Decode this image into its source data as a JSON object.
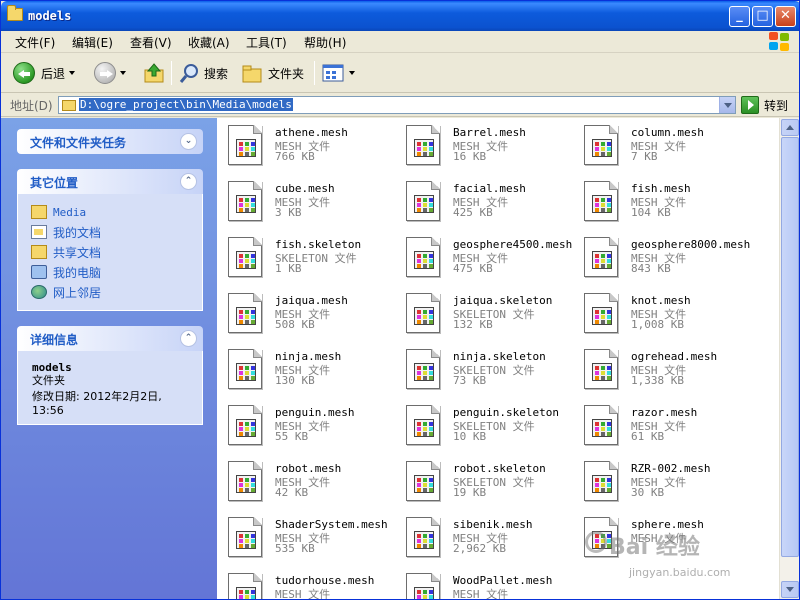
{
  "window": {
    "title": "models"
  },
  "menu": [
    "文件(F)",
    "编辑(E)",
    "查看(V)",
    "收藏(A)",
    "工具(T)",
    "帮助(H)"
  ],
  "toolbar": {
    "back": "后退",
    "search": "搜索",
    "folders": "文件夹"
  },
  "address": {
    "label": "地址(D)",
    "value": "D:\\ogre_project\\bin\\Media\\models",
    "go": "转到"
  },
  "tasks_panel": {
    "title": "文件和文件夹任务"
  },
  "other_places": {
    "title": "其它位置",
    "items": [
      {
        "label": "Media",
        "icon": "folder-icon"
      },
      {
        "label": "我的文档",
        "icon": "documents-icon"
      },
      {
        "label": "共享文档",
        "icon": "folder-icon"
      },
      {
        "label": "我的电脑",
        "icon": "computer-icon"
      },
      {
        "label": "网上邻居",
        "icon": "network-icon"
      }
    ]
  },
  "details": {
    "title": "详细信息",
    "name": "models",
    "type": "文件夹",
    "modified_line1": "修改日期: 2012年2月2日,",
    "modified_line2": "13:56"
  },
  "files": [
    {
      "name": "athene.mesh",
      "type": "MESH 文件",
      "size": "766 KB"
    },
    {
      "name": "Barrel.mesh",
      "type": "MESH 文件",
      "size": "16 KB"
    },
    {
      "name": "column.mesh",
      "type": "MESH 文件",
      "size": "7 KB"
    },
    {
      "name": "cube.mesh",
      "type": "MESH 文件",
      "size": "3 KB"
    },
    {
      "name": "facial.mesh",
      "type": "MESH 文件",
      "size": "425 KB"
    },
    {
      "name": "fish.mesh",
      "type": "MESH 文件",
      "size": "104 KB"
    },
    {
      "name": "fish.skeleton",
      "type": "SKELETON 文件",
      "size": "1 KB"
    },
    {
      "name": "geosphere4500.mesh",
      "type": "MESH 文件",
      "size": "475 KB"
    },
    {
      "name": "geosphere8000.mesh",
      "type": "MESH 文件",
      "size": "843 KB"
    },
    {
      "name": "jaiqua.mesh",
      "type": "MESH 文件",
      "size": "508 KB"
    },
    {
      "name": "jaiqua.skeleton",
      "type": "SKELETON 文件",
      "size": "132 KB"
    },
    {
      "name": "knot.mesh",
      "type": "MESH 文件",
      "size": "1,008 KB"
    },
    {
      "name": "ninja.mesh",
      "type": "MESH 文件",
      "size": "130 KB"
    },
    {
      "name": "ninja.skeleton",
      "type": "SKELETON 文件",
      "size": "73 KB"
    },
    {
      "name": "ogrehead.mesh",
      "type": "MESH 文件",
      "size": "1,338 KB"
    },
    {
      "name": "penguin.mesh",
      "type": "MESH 文件",
      "size": "55 KB"
    },
    {
      "name": "penguin.skeleton",
      "type": "SKELETON 文件",
      "size": "10 KB"
    },
    {
      "name": "razor.mesh",
      "type": "MESH 文件",
      "size": "61 KB"
    },
    {
      "name": "robot.mesh",
      "type": "MESH 文件",
      "size": "42 KB"
    },
    {
      "name": "robot.skeleton",
      "type": "SKELETON 文件",
      "size": "19 KB"
    },
    {
      "name": "RZR-002.mesh",
      "type": "MESH 文件",
      "size": "30 KB"
    },
    {
      "name": "ShaderSystem.mesh",
      "type": "MESH 文件",
      "size": "535 KB"
    },
    {
      "name": "sibenik.mesh",
      "type": "MESH 文件",
      "size": "2,962 KB"
    },
    {
      "name": "sphere.mesh",
      "type": "MESH 文件",
      "size": ""
    },
    {
      "name": "tudorhouse.mesh",
      "type": "MESH 文件",
      "size": ""
    },
    {
      "name": "WoodPallet.mesh",
      "type": "MESH 文件",
      "size": ""
    }
  ],
  "watermark": {
    "text": "Bai 经验",
    "url": "jingyan.baidu.com"
  },
  "colors": {
    "title_bar": "#0d5bdc",
    "task_pane": "#7ba2e7",
    "link": "#215dc6",
    "selection": "#316ac5"
  }
}
